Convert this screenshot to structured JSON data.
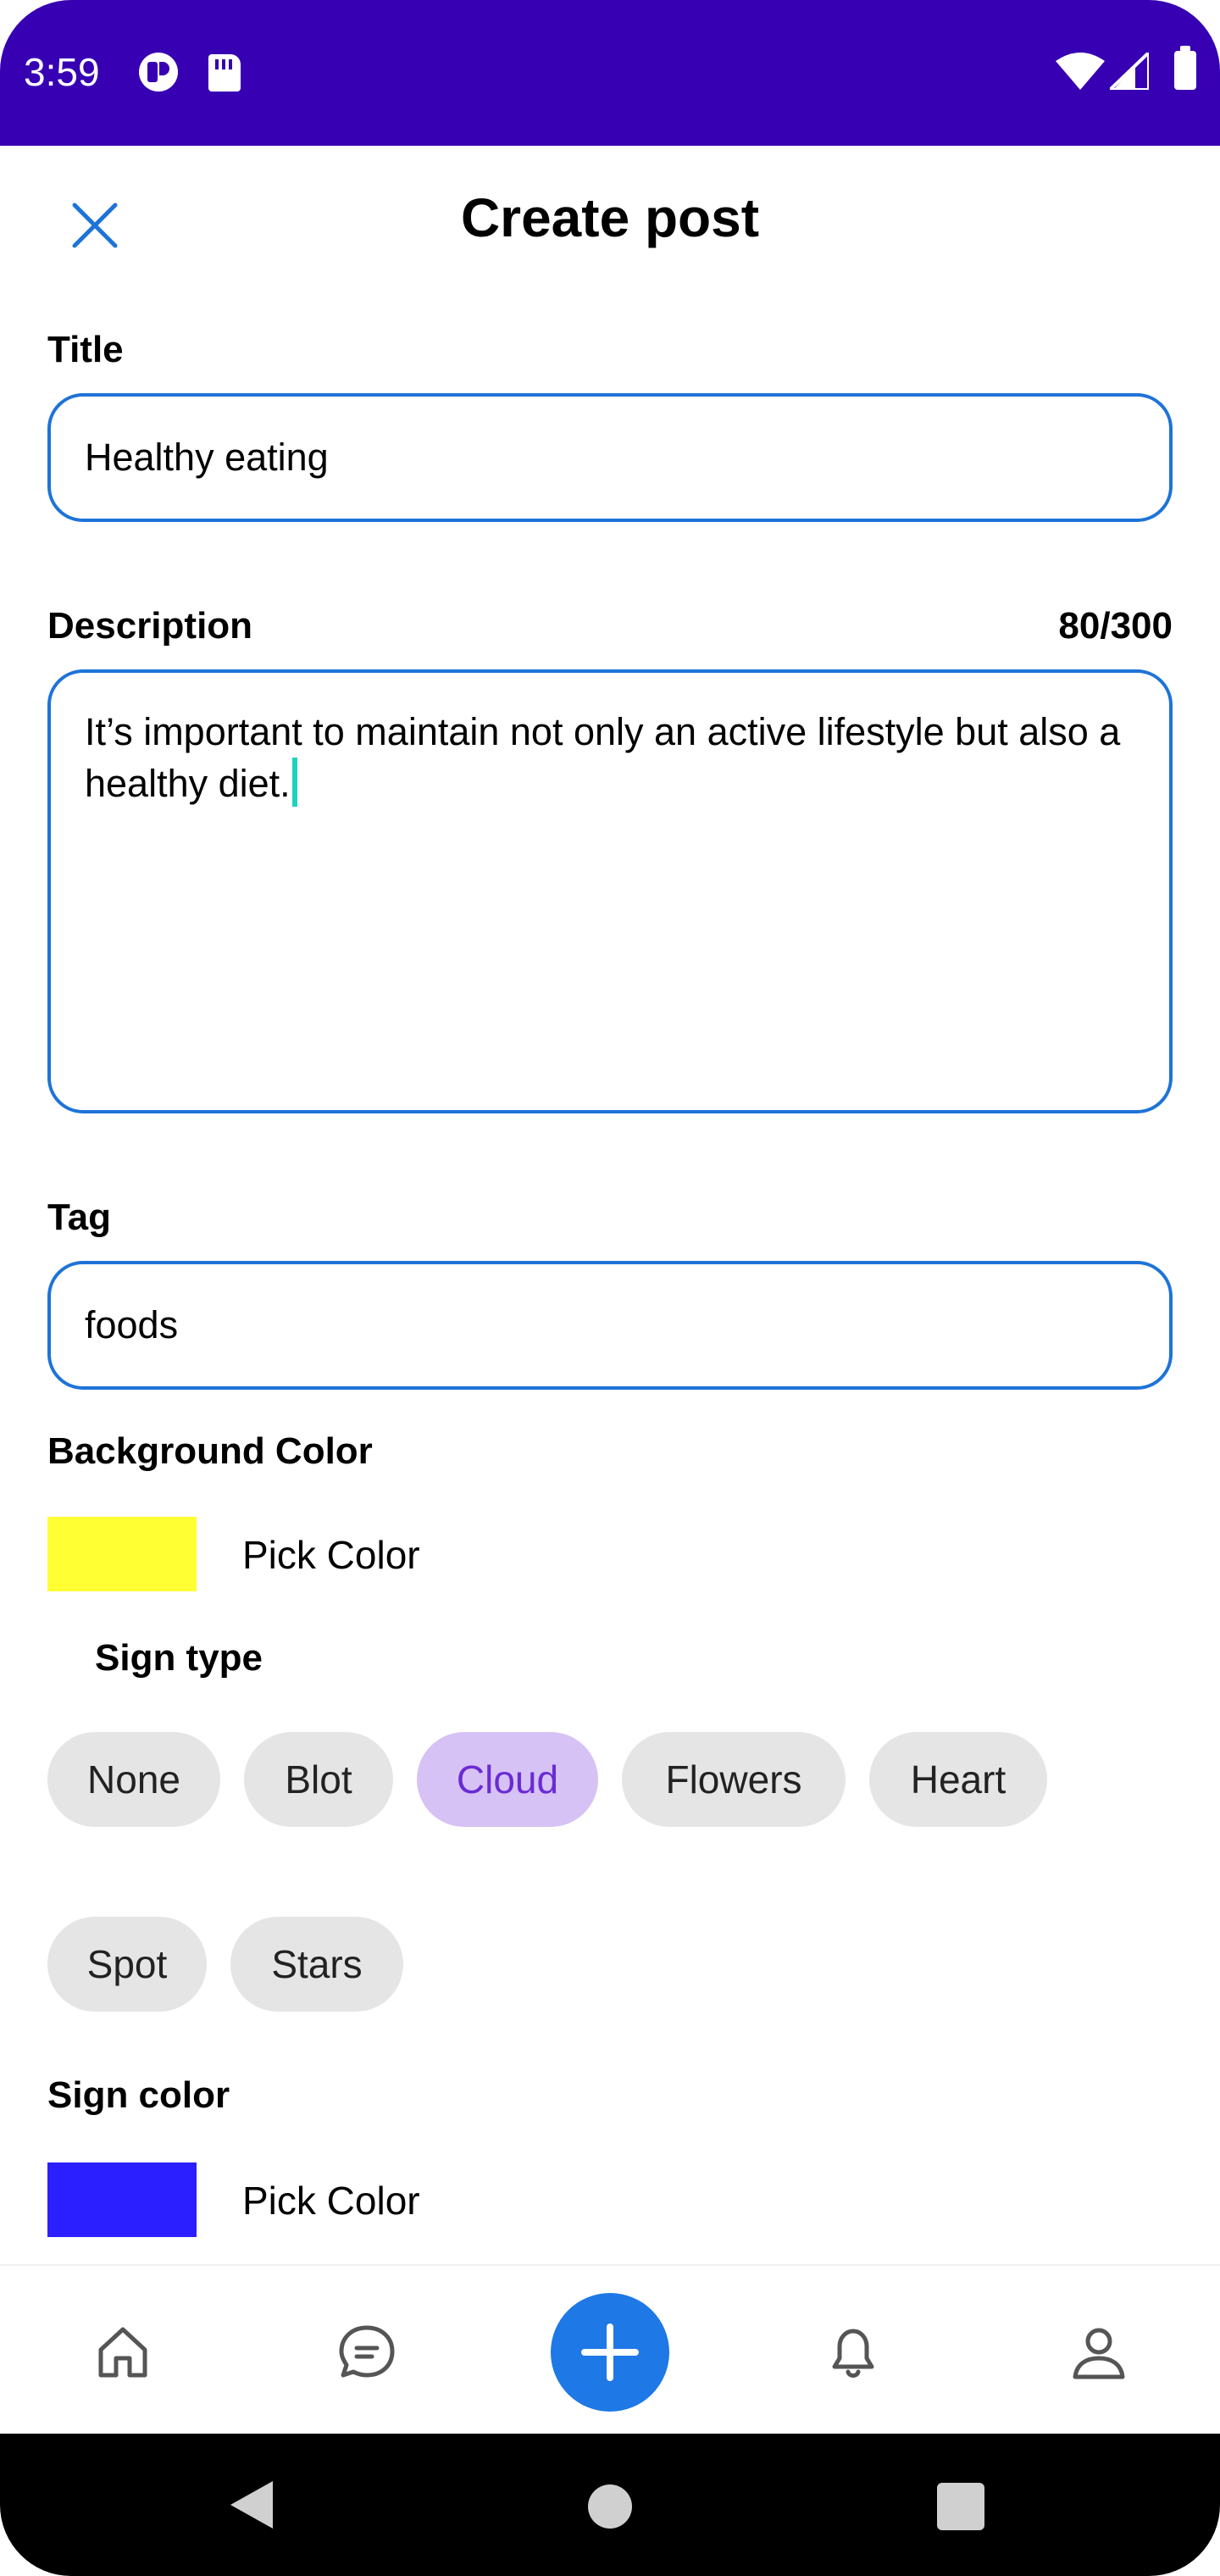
{
  "status_bar": {
    "time": "3:59",
    "background": "#3700b3",
    "icons": [
      "app-icon",
      "sd-card-icon",
      "wifi-icon",
      "signal-icon",
      "battery-icon"
    ]
  },
  "header": {
    "title": "Create post",
    "close_icon": "close-icon"
  },
  "form": {
    "title": {
      "label": "Title",
      "value": "Healthy eating"
    },
    "description": {
      "label": "Description",
      "counter": "80/300",
      "value": "It’s important to maintain not only an active lifestyle but also a healthy diet."
    },
    "tag": {
      "label": "Tag",
      "value": "foods"
    },
    "background_color": {
      "label": "Background Color",
      "swatch": "#ffff33",
      "pick_label": "Pick Color"
    },
    "sign_type": {
      "label": "Sign type",
      "options": [
        "None",
        "Blot",
        "Cloud",
        "Flowers",
        "Heart",
        "Spot",
        "Stars"
      ],
      "selected": "Cloud"
    },
    "sign_color": {
      "label": "Sign color",
      "swatch": "#2b1fff",
      "pick_label": "Pick Color"
    }
  },
  "bottom_nav": {
    "items": [
      "home-icon",
      "chat-icon",
      "add-icon",
      "bell-icon",
      "profile-icon"
    ],
    "accent": "#1e78e6"
  },
  "colors": {
    "input_border": "#1e73d8",
    "chip_bg": "#e5e5e5",
    "chip_selected_bg": "#d6c2f4",
    "chip_selected_text": "#6a2bd4"
  }
}
